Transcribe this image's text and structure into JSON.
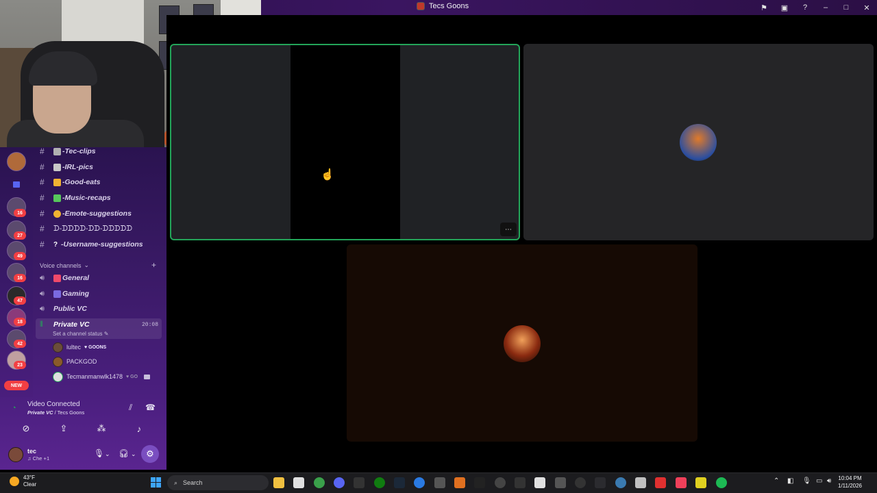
{
  "window": {
    "title": "Tecs Goons"
  },
  "server_badges": [
    "16",
    "27",
    "49",
    "16",
    "47",
    "18",
    "42",
    "23"
  ],
  "new_label": "NEW",
  "text_channels": [
    {
      "name": "-Tec-clips",
      "emoji_color": "#b0b0b0"
    },
    {
      "name": "-IRL-pics",
      "emoji_color": "#c8c8c8"
    },
    {
      "name": "-Good-eats",
      "emoji_color": "#f0b232"
    },
    {
      "name": "-Music-recaps",
      "emoji_color": "#57c75c"
    },
    {
      "name": "-Emote-suggestions",
      "emoji_color": "#f0b232"
    },
    {
      "name": "ᗪ-ᗪᗪᗪᗪ-ᗪᗪ-ᗪᗪᗪᗪᗪ",
      "emoji_color": ""
    },
    {
      "name": "-Username-suggestions",
      "emoji_color": "#ffffff"
    }
  ],
  "voice_section": {
    "label": "Voice channels",
    "add": "+"
  },
  "voice_channels": [
    {
      "name": "General",
      "emoji_color": "#f04a6a"
    },
    {
      "name": "Gaming",
      "emoji_color": "#7a6ae0"
    },
    {
      "name": "Public VC",
      "emoji_color": ""
    }
  ],
  "private_vc": {
    "name": "Private VC",
    "time": "20:08",
    "status": "Set a channel status"
  },
  "members": [
    {
      "name": "lultec",
      "tag": "GOONS"
    },
    {
      "name": "PACKGOD",
      "tag": ""
    },
    {
      "name": "Tecmanmanwlk1478",
      "tag": "GO"
    }
  ],
  "voice_panel": {
    "title": "Video Connected",
    "channel": "Private VC",
    "server": "Tecs Goons",
    "separator": " / "
  },
  "user": {
    "name": "tec",
    "status": "Che +1"
  },
  "taskbar": {
    "weather_temp": "43°F",
    "weather_desc": "Clear",
    "search_placeholder": "Search",
    "time": "10:04 PM",
    "date": "1/11/2026"
  },
  "icons": {
    "flag": "flag-icon",
    "screen": "screen-icon",
    "help": "help-icon",
    "minimize": "minimize-icon",
    "maximize": "maximize-icon",
    "close": "close-icon",
    "more": "more-icon",
    "cursor": "cursor-icon"
  },
  "colors": {
    "accent": "#23a559",
    "badge": "#f23f43",
    "sidebar_top": "#2a1350",
    "sidebar_bottom": "#4b1f7f"
  }
}
